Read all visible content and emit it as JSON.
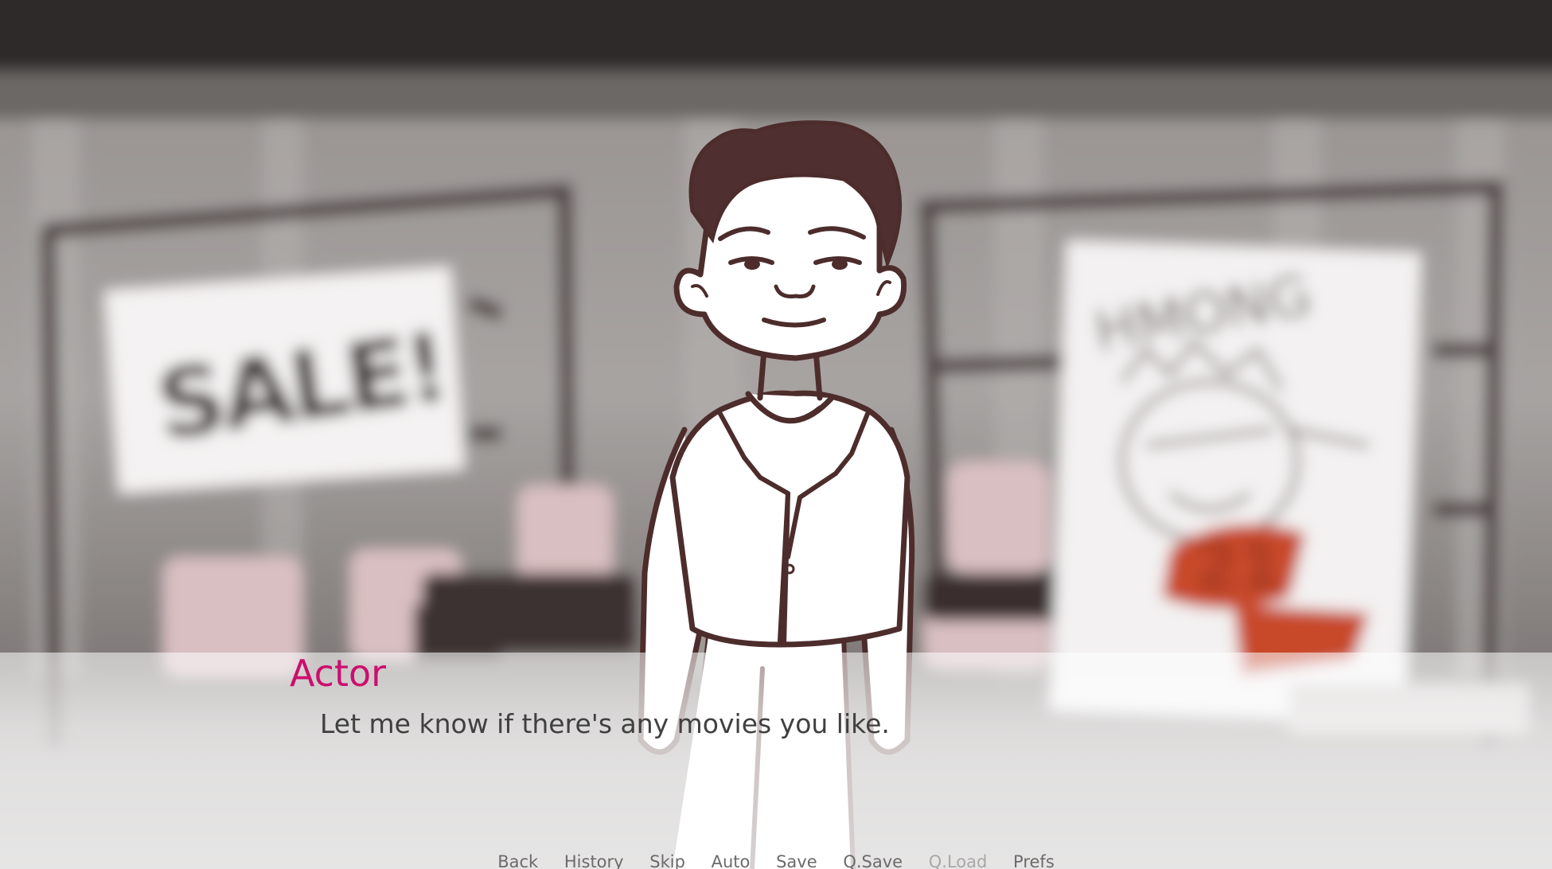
{
  "scene": {
    "left_sign_text": "SALE!",
    "right_sign_text": "HMONG",
    "right_sign_badge": "21",
    "colors": {
      "ink": "#4d2c2c",
      "shelf_pink": "#d9bfc1",
      "badge_red": "#c8482a"
    }
  },
  "dialogue": {
    "speaker": "Actor",
    "text": "Let me know if there's any movies you like.",
    "speaker_color": "#cc0e6e",
    "text_color": "#404040"
  },
  "quick_menu": {
    "items": [
      {
        "label": "Back",
        "enabled": true
      },
      {
        "label": "History",
        "enabled": true
      },
      {
        "label": "Skip",
        "enabled": true
      },
      {
        "label": "Auto",
        "enabled": true
      },
      {
        "label": "Save",
        "enabled": true
      },
      {
        "label": "Q.Save",
        "enabled": true
      },
      {
        "label": "Q.Load",
        "enabled": false
      },
      {
        "label": "Prefs",
        "enabled": true
      }
    ]
  }
}
